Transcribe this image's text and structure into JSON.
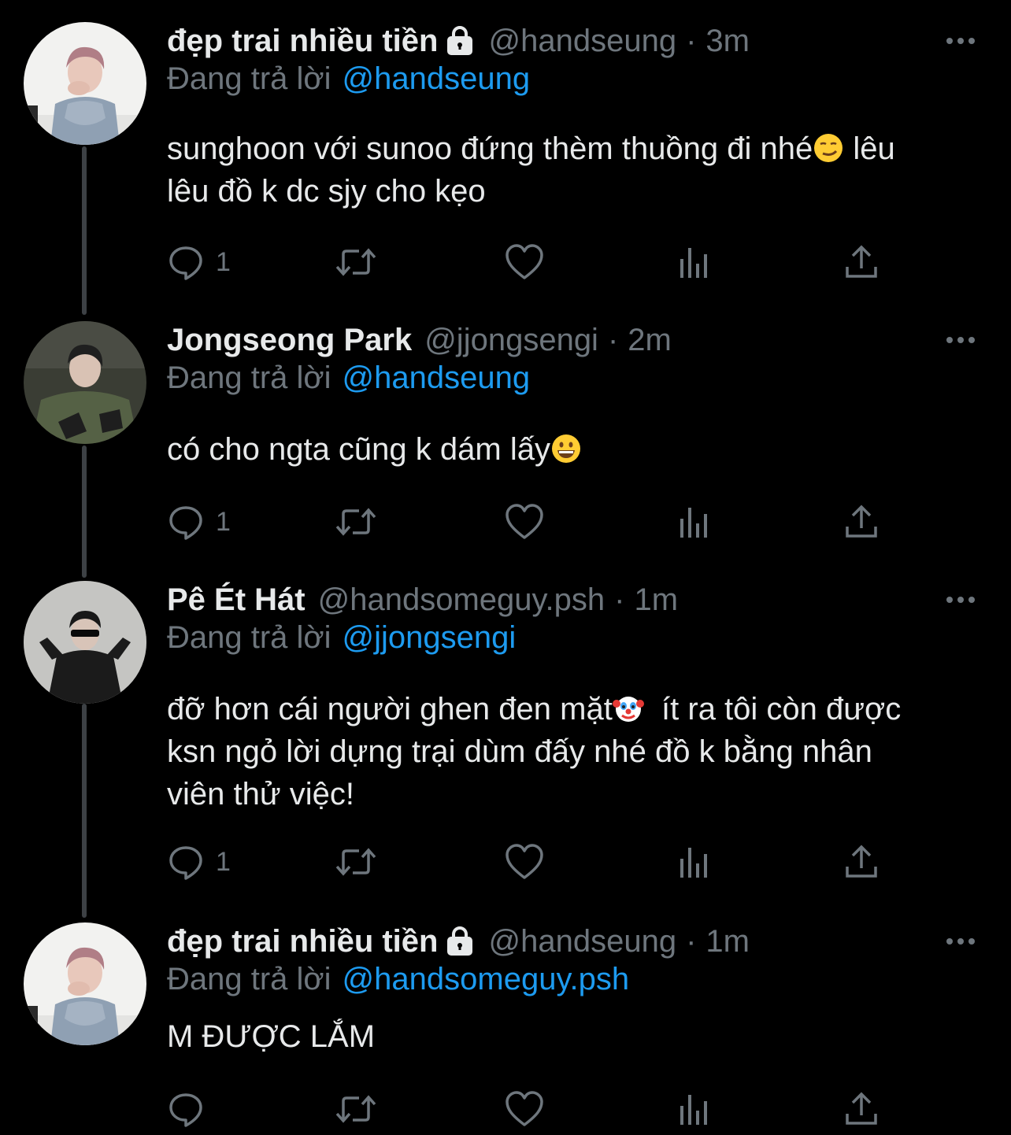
{
  "colors": {
    "background": "#000000",
    "text": "#e7e9ea",
    "muted": "#6e767d",
    "link": "#1d9bf0",
    "thread_line": "#3d4145"
  },
  "reply_prefix": "Đang trả lời",
  "tweets": [
    {
      "display_name": "đẹp trai nhiều tiền",
      "protected": true,
      "handle": "@handseung",
      "separator": "·",
      "time": "3m",
      "reply_to": "@handseung",
      "text_lines": [
        [
          "sunghoon với sunoo đứng thèm thuồng đi nhé",
          "smirk-emoji",
          " lêu"
        ],
        [
          "lêu đồ k dc sjy cho kẹo"
        ]
      ],
      "reply_count": "1",
      "avatar": "avatar-person-grey-sweater"
    },
    {
      "display_name": "Jongseong Park",
      "protected": false,
      "handle": "@jjongsengi",
      "separator": "·",
      "time": "2m",
      "reply_to": "@handseung",
      "text_lines": [
        [
          "có cho ngta cũng k dám lấy",
          "grinning-emoji"
        ]
      ],
      "reply_count": "1",
      "avatar": "avatar-person-dark-jacket"
    },
    {
      "display_name": "Pê Ét Hát",
      "protected": false,
      "handle": "@handsomeguy.psh",
      "separator": "·",
      "time": "1m",
      "reply_to": "@jjongsengi",
      "text_lines": [
        [
          "đỡ hơn cái người ghen đen mặt",
          "clown-emoji",
          "  ít ra tôi còn được"
        ],
        [
          "ksn ngỏ lời dựng trại dùm đấy nhé đồ k bằng nhân"
        ],
        [
          "viên thử việc!"
        ]
      ],
      "reply_count": "1",
      "avatar": "avatar-person-sunglasses"
    },
    {
      "display_name": "đẹp trai nhiều tiền",
      "protected": true,
      "handle": "@handseung",
      "separator": "·",
      "time": "1m",
      "reply_to": "@handsomeguy.psh",
      "text_lines": [
        [
          "M ĐƯỢC LẮM"
        ]
      ],
      "reply_count": "",
      "avatar": "avatar-person-grey-sweater"
    }
  ]
}
